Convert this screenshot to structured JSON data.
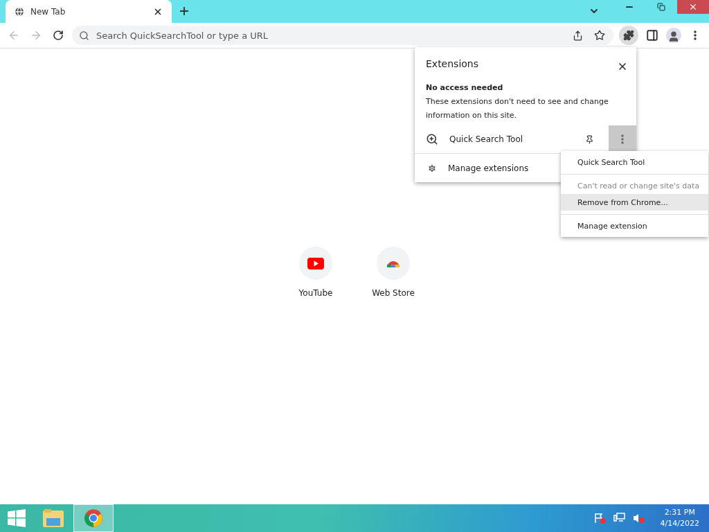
{
  "tabs": [
    {
      "title": "New Tab",
      "selected": true
    }
  ],
  "omnibox": {
    "placeholder": "Search QuickSearchTool or type a URL"
  },
  "toolbar": {
    "extensions_active": true
  },
  "extensions_popup": {
    "title": "Extensions",
    "section_heading": "No access needed",
    "section_text": "These extensions don't need to see and change information on this site.",
    "items": [
      {
        "name": "Quick Search Tool",
        "menu_open": true
      }
    ],
    "manage": "Manage extensions"
  },
  "context_menu": {
    "items": [
      {
        "label": "Quick Search Tool",
        "disabled": false,
        "selected": false
      },
      {
        "label": "Can't read or change site's data",
        "disabled": true,
        "selected": false
      },
      {
        "label": "Remove from Chrome...",
        "disabled": false,
        "selected": true
      },
      {
        "label": "Manage extension",
        "disabled": false,
        "selected": false
      }
    ]
  },
  "shortcuts": [
    {
      "label": "YouTube",
      "kind": "youtube"
    },
    {
      "label": "Web Store",
      "kind": "webstore"
    }
  ],
  "taskbar": {
    "apps": [
      {
        "kind": "explorer",
        "selected": false
      },
      {
        "kind": "chrome",
        "selected": true
      }
    ],
    "time": "2:31 PM",
    "date": "4/14/2022"
  }
}
